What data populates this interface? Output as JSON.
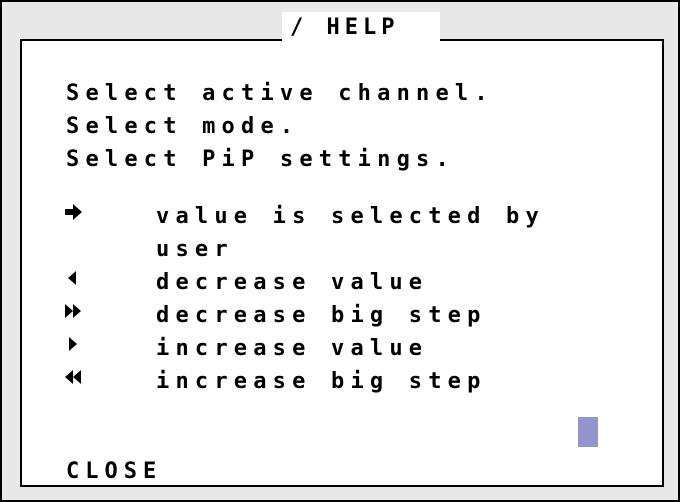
{
  "dialog": {
    "title": "/ HELP",
    "close_label": "CLOSE",
    "cursor_color": "#9494cc"
  },
  "instructions": [
    "Select active channel.",
    "Select mode.",
    "Select PiP settings."
  ],
  "legend": [
    {
      "icon": "arrow-right-icon",
      "text": "value is selected by"
    },
    {
      "icon": "",
      "text": "user"
    },
    {
      "icon": "triangle-left-icon",
      "text": "decrease value"
    },
    {
      "icon": "double-triangle-right-icon",
      "text": "decrease big step"
    },
    {
      "icon": "triangle-right-icon",
      "text": "increase value"
    },
    {
      "icon": "double-triangle-left-icon",
      "text": "increase big step"
    }
  ]
}
